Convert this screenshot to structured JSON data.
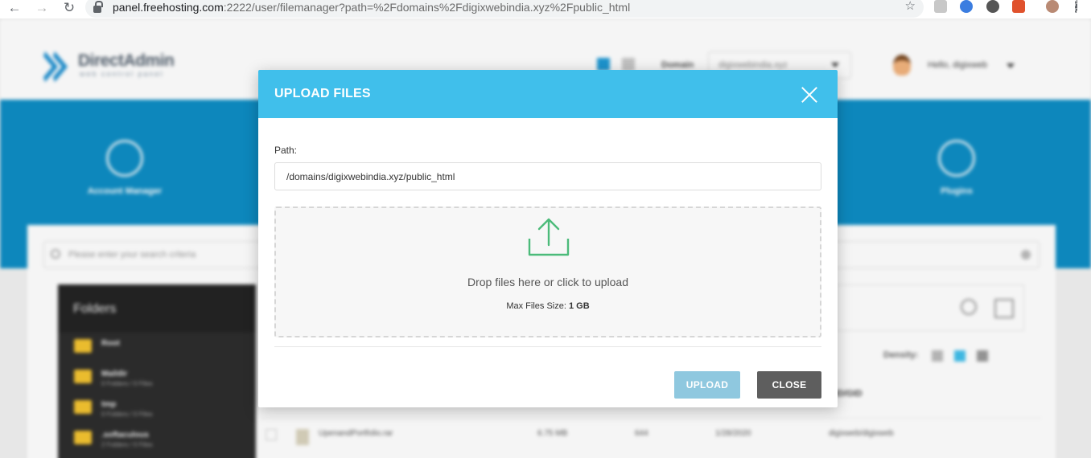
{
  "browser": {
    "url_host": "panel.freehosting.com",
    "url_path": ":2222/user/filemanager?path=%2Fdomains%2Fdigixwebindia.xyz%2Fpublic_html"
  },
  "app": {
    "logo": {
      "title": "DirectAdmin",
      "subtitle": "web control panel"
    },
    "domain_label": "Domain",
    "domain_value": "digixwebindia.xyz",
    "greeting": "Hello, digixweb",
    "band_items": [
      "Account Manager",
      "Plugins"
    ],
    "search_placeholder": "Please enter your search criteria",
    "folders": {
      "heading": "Folders",
      "items": [
        {
          "name": "Root",
          "meta": ""
        },
        {
          "name": "Maildir",
          "meta": "0 Folders / 0 Files"
        },
        {
          "name": "tmp",
          "meta": "0 Folders / 0 Files"
        },
        {
          "name": ".softaculous",
          "meta": "2 Folders / 0 Files"
        }
      ]
    },
    "density_label": "Density:",
    "uid_header": "UID/GID",
    "file_row": {
      "name": "UpenandPortfolio.rar",
      "size": "6.75 MB",
      "perm": "644",
      "date": "1/28/2020",
      "owner": "digixweb/digixweb"
    }
  },
  "modal": {
    "title": "UPLOAD FILES",
    "path_label": "Path:",
    "path_value": "/domains/digixwebindia.xyz/public_html",
    "drop_text": "Drop files here or click to upload",
    "max_size_label": "Max Files Size:",
    "max_size_value": "1 GB",
    "upload_button": "UPLOAD",
    "close_button": "CLOSE",
    "accent_color": "#40bfeb",
    "upload_icon_color": "#4cbb7a"
  }
}
